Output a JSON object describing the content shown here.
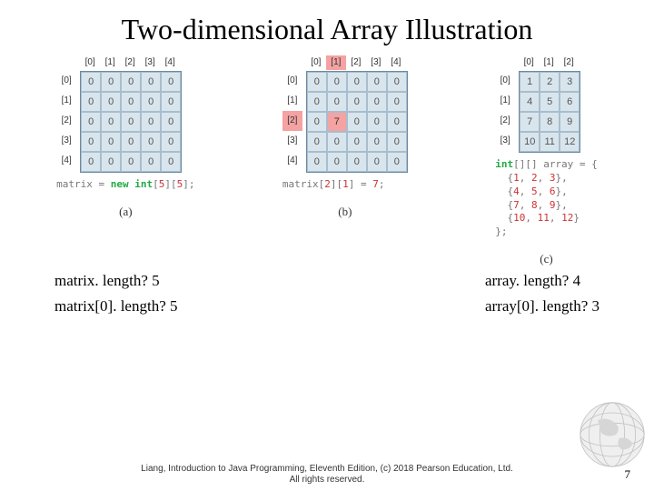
{
  "title": "Two-dimensional Array Illustration",
  "figA": {
    "cols": [
      "[0]",
      "[1]",
      "[2]",
      "[3]",
      "[4]"
    ],
    "rows": [
      "[0]",
      "[1]",
      "[2]",
      "[3]",
      "[4]"
    ],
    "cells": [
      [
        "0",
        "0",
        "0",
        "0",
        "0"
      ],
      [
        "0",
        "0",
        "0",
        "0",
        "0"
      ],
      [
        "0",
        "0",
        "0",
        "0",
        "0"
      ],
      [
        "0",
        "0",
        "0",
        "0",
        "0"
      ],
      [
        "0",
        "0",
        "0",
        "0",
        "0"
      ]
    ],
    "code_pre": "matrix = ",
    "code_kw": "new int",
    "code_post1": "[",
    "code_n1": "5",
    "code_mid": "][",
    "code_n2": "5",
    "code_post2": "];",
    "sub": "(a)"
  },
  "figB": {
    "cols": [
      "[0]",
      "[1]",
      "[2]",
      "[3]",
      "[4]"
    ],
    "rows": [
      "[0]",
      "[1]",
      "[2]",
      "[3]",
      "[4]"
    ],
    "hlCol": 1,
    "hlRow": 2,
    "cells": [
      [
        "0",
        "0",
        "0",
        "0",
        "0"
      ],
      [
        "0",
        "0",
        "0",
        "0",
        "0"
      ],
      [
        "0",
        "7",
        "0",
        "0",
        "0"
      ],
      [
        "0",
        "0",
        "0",
        "0",
        "0"
      ],
      [
        "0",
        "0",
        "0",
        "0",
        "0"
      ]
    ],
    "code_pre": "matrix[",
    "code_n1": "2",
    "code_mid": "][",
    "code_n2": "1",
    "code_post": "] = ",
    "code_n3": "7",
    "code_end": ";",
    "sub": "(b)"
  },
  "figC": {
    "cols": [
      "[0]",
      "[1]",
      "[2]"
    ],
    "rows": [
      "[0]",
      "[1]",
      "[2]",
      "[3]"
    ],
    "cells": [
      [
        "1",
        "2",
        "3"
      ],
      [
        "4",
        "5",
        "6"
      ],
      [
        "7",
        "8",
        "9"
      ],
      [
        "10",
        "11",
        "12"
      ]
    ],
    "decl_kw": "int",
    "decl_post": "[][] array = {",
    "lines": [
      {
        "open": "{",
        "a": "1",
        "s1": ", ",
        "b": "2",
        "s2": ", ",
        "c": "3",
        "close": "},"
      },
      {
        "open": "{",
        "a": "4",
        "s1": ", ",
        "b": "5",
        "s2": ", ",
        "c": "6",
        "close": "},"
      },
      {
        "open": "{",
        "a": "7",
        "s1": ", ",
        "b": "8",
        "s2": ", ",
        "c": "9",
        "close": "},"
      },
      {
        "open": "{",
        "a": "10",
        "s1": ", ",
        "b": "11",
        "s2": ", ",
        "c": "12",
        "close": "}"
      }
    ],
    "end": "};",
    "sub": "(c)"
  },
  "qa": {
    "l1": "matrix. length?  5",
    "l2": "matrix[0]. length?  5",
    "r1": "array. length?  4",
    "r2": "array[0]. length? 3"
  },
  "cite1": "Liang, Introduction to Java Programming, Eleventh Edition, (c) 2018 Pearson Education, Ltd.",
  "cite2": "All rights reserved.",
  "page": "7"
}
